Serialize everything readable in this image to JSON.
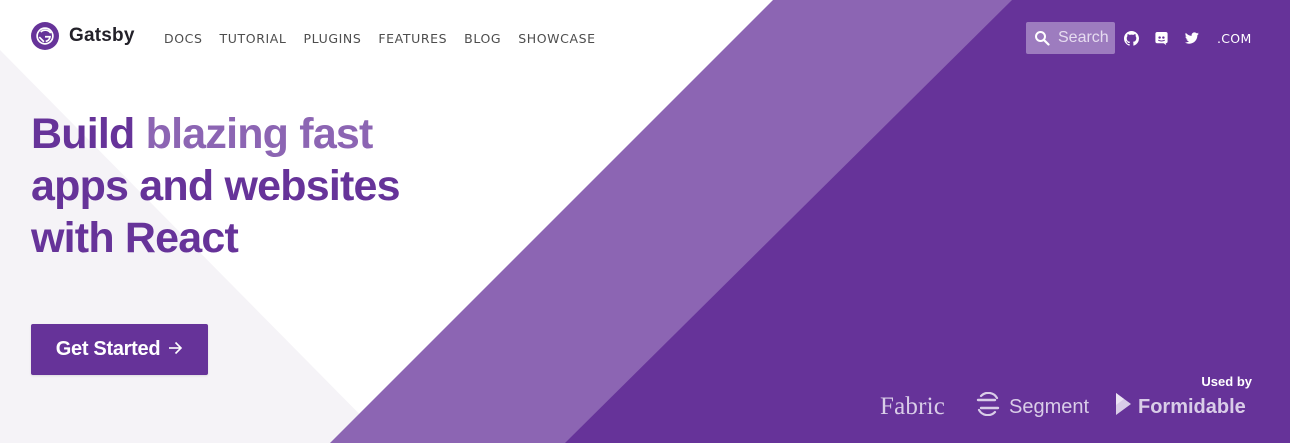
{
  "header": {
    "brand": "Gatsby",
    "nav": [
      {
        "label": "DOCS"
      },
      {
        "label": "TUTORIAL"
      },
      {
        "label": "PLUGINS"
      },
      {
        "label": "FEATURES"
      },
      {
        "label": "BLOG"
      },
      {
        "label": "SHOWCASE"
      }
    ],
    "search": {
      "placeholder": "Search",
      "icon": "search-icon"
    },
    "social": [
      {
        "icon": "github-icon"
      },
      {
        "icon": "discord-icon"
      },
      {
        "icon": "twitter-icon"
      }
    ],
    "dotcom": ".COM"
  },
  "hero": {
    "title_part1": "Build ",
    "title_accent": "blazing fast",
    "title_part2": "apps and websites with React",
    "cta_label": "Get Started",
    "cta_icon": "arrow-right-icon"
  },
  "used_by": {
    "label": "Used by",
    "clients": [
      {
        "name": "Fabric"
      },
      {
        "name": "Segment",
        "icon": "segment-icon"
      },
      {
        "name": "Formidable",
        "icon": "formidable-icon"
      }
    ]
  },
  "colors": {
    "brand": "#663399",
    "brand_light": "#8c65b3",
    "search_bg": "#9d7cbf",
    "light_triangle": "#f5f3f7",
    "white": "#ffffff"
  }
}
